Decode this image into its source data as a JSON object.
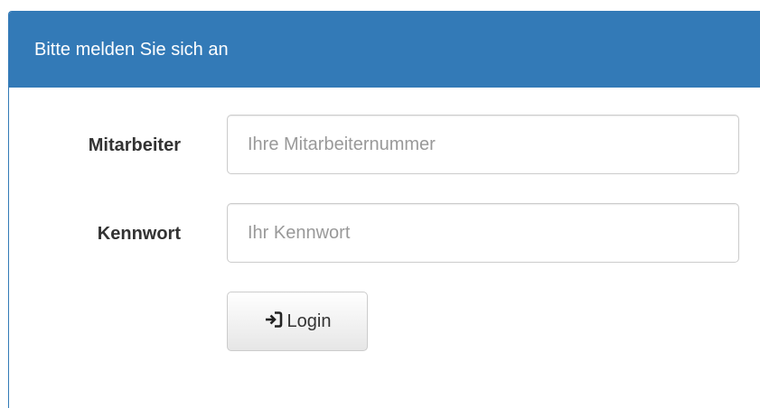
{
  "panel": {
    "title": "Bitte melden Sie sich an"
  },
  "form": {
    "employee": {
      "label": "Mitarbeiter",
      "placeholder": "Ihre Mitarbeiternummer",
      "value": ""
    },
    "password": {
      "label": "Kennwort",
      "placeholder": "Ihr Kennwort",
      "value": ""
    },
    "login_button": {
      "label": "Login",
      "icon": "log-in-icon",
      "icon_glyph": "⮑"
    }
  },
  "colors": {
    "header_bg": "#337ab7",
    "header_text": "#ffffff",
    "border": "#cccccc"
  }
}
